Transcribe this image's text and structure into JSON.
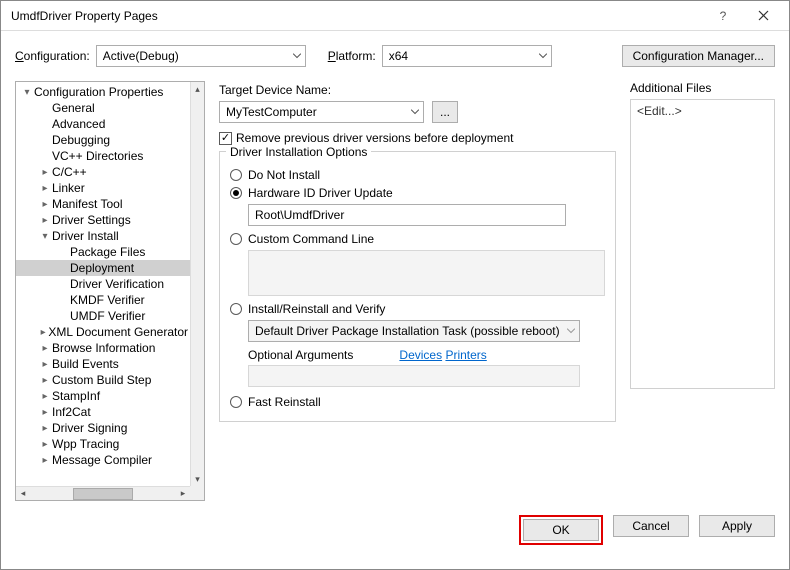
{
  "window": {
    "title": "UmdfDriver Property Pages"
  },
  "config_row": {
    "config_label": "Configuration:",
    "config_value": "Active(Debug)",
    "platform_label": "Platform:",
    "platform_value": "x64",
    "config_mgr_label": "Configuration Manager..."
  },
  "tree": {
    "items": [
      {
        "label": "Configuration Properties",
        "lvl": 0,
        "exp": "▾"
      },
      {
        "label": "General",
        "lvl": 1,
        "exp": ""
      },
      {
        "label": "Advanced",
        "lvl": 1,
        "exp": ""
      },
      {
        "label": "Debugging",
        "lvl": 1,
        "exp": ""
      },
      {
        "label": "VC++ Directories",
        "lvl": 1,
        "exp": ""
      },
      {
        "label": "C/C++",
        "lvl": 1,
        "exp": "▸"
      },
      {
        "label": "Linker",
        "lvl": 1,
        "exp": "▸"
      },
      {
        "label": "Manifest Tool",
        "lvl": 1,
        "exp": "▸"
      },
      {
        "label": "Driver Settings",
        "lvl": 1,
        "exp": "▸"
      },
      {
        "label": "Driver Install",
        "lvl": 1,
        "exp": "▾"
      },
      {
        "label": "Package Files",
        "lvl": 2,
        "exp": ""
      },
      {
        "label": "Deployment",
        "lvl": 2,
        "exp": "",
        "selected": true
      },
      {
        "label": "Driver Verification",
        "lvl": 2,
        "exp": ""
      },
      {
        "label": "KMDF Verifier",
        "lvl": 2,
        "exp": ""
      },
      {
        "label": "UMDF Verifier",
        "lvl": 2,
        "exp": ""
      },
      {
        "label": "XML Document Generator",
        "lvl": 1,
        "exp": "▸"
      },
      {
        "label": "Browse Information",
        "lvl": 1,
        "exp": "▸"
      },
      {
        "label": "Build Events",
        "lvl": 1,
        "exp": "▸"
      },
      {
        "label": "Custom Build Step",
        "lvl": 1,
        "exp": "▸"
      },
      {
        "label": "StampInf",
        "lvl": 1,
        "exp": "▸"
      },
      {
        "label": "Inf2Cat",
        "lvl": 1,
        "exp": "▸"
      },
      {
        "label": "Driver Signing",
        "lvl": 1,
        "exp": "▸"
      },
      {
        "label": "Wpp Tracing",
        "lvl": 1,
        "exp": "▸"
      },
      {
        "label": "Message Compiler",
        "lvl": 1,
        "exp": "▸"
      }
    ]
  },
  "main": {
    "target_label": "Target Device Name:",
    "target_value": "MyTestComputer",
    "browse_label": "...",
    "remove_checkbox_label": "Remove previous driver versions before deployment",
    "remove_checked": true,
    "group_legend": "Driver Installation Options",
    "radio_do_not_install": "Do Not Install",
    "radio_hwid": "Hardware ID Driver Update",
    "hwid_value": "Root\\UmdfDriver",
    "radio_custom": "Custom Command Line",
    "radio_install_verify": "Install/Reinstall and Verify",
    "task_value": "Default Driver Package Installation Task (possible reboot)",
    "optional_label": "Optional Arguments",
    "devices_link": "Devices",
    "printers_link": "Printers",
    "radio_fast": "Fast Reinstall",
    "additional_label": "Additional Files",
    "additional_value": "<Edit...>"
  },
  "footer": {
    "ok": "OK",
    "cancel": "Cancel",
    "apply": "Apply"
  }
}
